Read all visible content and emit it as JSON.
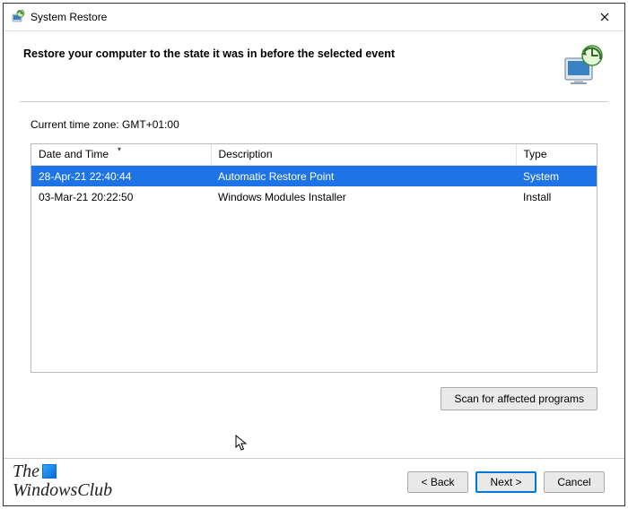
{
  "window": {
    "title": "System Restore"
  },
  "heading": "Restore your computer to the state it was in before the selected event",
  "timezone_label": "Current time zone: GMT+01:00",
  "columns": {
    "datetime": "Date and Time",
    "description": "Description",
    "type": "Type"
  },
  "rows": [
    {
      "datetime": "28-Apr-21 22:40:44",
      "description": "Automatic Restore Point",
      "type": "System",
      "selected": true
    },
    {
      "datetime": "03-Mar-21 20:22:50",
      "description": "Windows Modules Installer",
      "type": "Install",
      "selected": false
    }
  ],
  "buttons": {
    "scan": "Scan for affected programs",
    "back": "< Back",
    "next": "Next >",
    "cancel": "Cancel"
  },
  "watermark": {
    "line1": "The",
    "line2": "WindowsClub"
  }
}
